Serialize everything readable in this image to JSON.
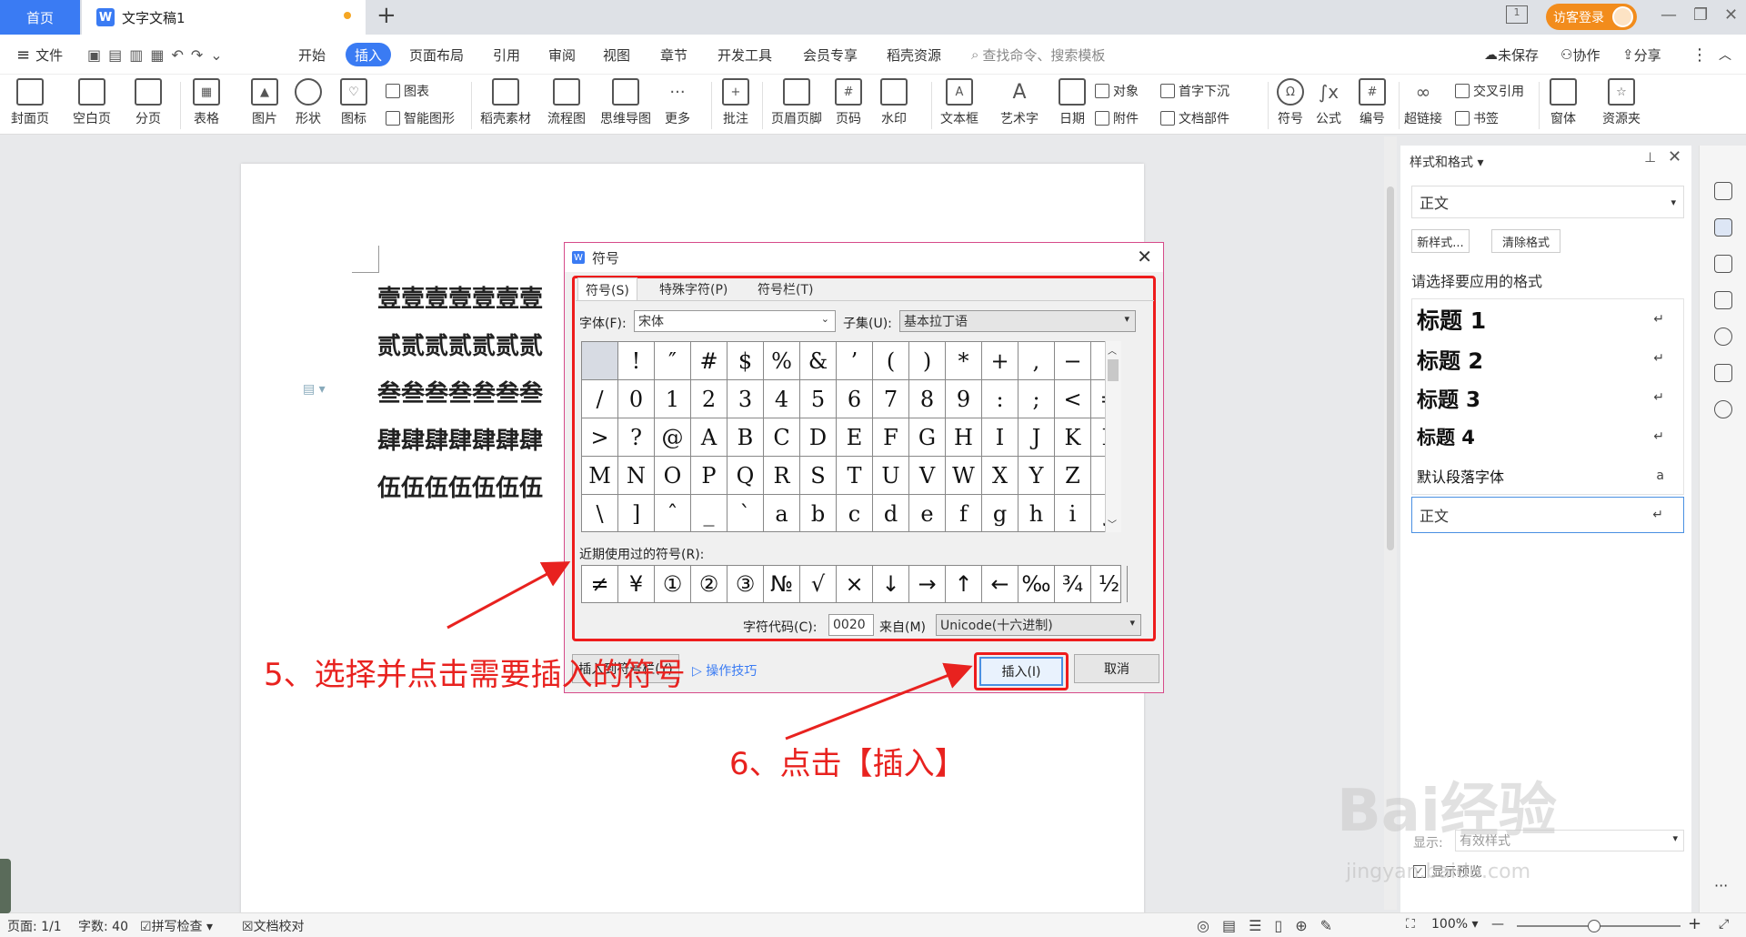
{
  "tabbar": {
    "home": "首页",
    "doc_title": "文字文稿1",
    "new_tab": "+",
    "login": "访客登录"
  },
  "menu": {
    "file": "文件",
    "items": [
      "开始",
      "插入",
      "页面布局",
      "引用",
      "审阅",
      "视图",
      "章节",
      "开发工具",
      "会员专享",
      "稻壳资源"
    ],
    "search": "查找命令、搜索模板",
    "unsaved": "未保存",
    "collab": "协作",
    "share": "分享"
  },
  "ribbon": {
    "cover": "封面页",
    "blank": "空白页",
    "pagebreak": "分页",
    "table": "表格",
    "picture": "图片",
    "shape": "形状",
    "icon": "图标",
    "chart": "图表",
    "smartart": "智能图形",
    "docer": "稻壳素材",
    "flow": "流程图",
    "mind": "思维导图",
    "more": "更多",
    "comment": "批注",
    "header": "页眉页脚",
    "pagenum": "页码",
    "watermark": "水印",
    "textbox": "文本框",
    "wordart": "艺术字",
    "date": "日期",
    "object": "对象",
    "attach": "附件",
    "dropcap": "首字下沉",
    "docpart": "文档部件",
    "symbol": "符号",
    "formula": "公式",
    "numbering": "编号",
    "crossref": "交叉引用",
    "bookmark": "书签",
    "hyperlink": "超链接",
    "window": "窗体",
    "resources": "资源夹"
  },
  "doc": {
    "lines": [
      "壹壹壹壹壹壹壹",
      "贰贰贰贰贰贰贰",
      "叁叁叁叁叁叁叁",
      "肆肆肆肆肆肆肆",
      "伍伍伍伍伍伍伍"
    ]
  },
  "dialog": {
    "title": "符号",
    "tabs": [
      "符号(S)",
      "特殊字符(P)",
      "符号栏(T)"
    ],
    "font_label": "字体(F):",
    "font_value": "宋体",
    "subset_label": "子集(U):",
    "subset_value": "基本拉丁语",
    "symbols": [
      " ",
      "!",
      "″",
      "#",
      "$",
      "%",
      "&",
      "’",
      "(",
      ")",
      "*",
      "+",
      ",",
      "−",
      ".",
      "/",
      "0",
      "1",
      "2",
      "3",
      "4",
      "5",
      "6",
      "7",
      "8",
      "9",
      ":",
      ";",
      "<",
      "=",
      ">",
      "?",
      "@",
      "A",
      "B",
      "C",
      "D",
      "E",
      "F",
      "G",
      "H",
      "I",
      "J",
      "K",
      "L",
      "M",
      "N",
      "O",
      "P",
      "Q",
      "R",
      "S",
      "T",
      "U",
      "V",
      "W",
      "X",
      "Y",
      "Z",
      "[",
      "\\",
      "]",
      "ˆ",
      "_",
      "ˋ",
      "a",
      "b",
      "c",
      "d",
      "e",
      "f",
      "g",
      "h",
      "i",
      "j"
    ],
    "recent_label": "近期使用过的符号(R):",
    "recent": [
      "≠",
      "¥",
      "①",
      "②",
      "③",
      "№",
      "√",
      "×",
      "↓",
      "→",
      "↑",
      "←",
      "‰",
      "¾",
      "½"
    ],
    "code_label": "字符代码(C):",
    "code_value": "0020",
    "from_label": "来自(M)",
    "from_value": "Unicode(十六进制)",
    "insert_to_bar": "插入到符号栏(Y)",
    "tips": "操作技巧",
    "insert": "插入(I)",
    "cancel": "取消"
  },
  "panel": {
    "title": "样式和格式",
    "current": "正文",
    "new_style": "新样式...",
    "clear_format": "清除格式",
    "prompt": "请选择要应用的格式",
    "styles": [
      "标题 1",
      "标题 2",
      "标题 3",
      "标题 4"
    ],
    "default_font": "默认段落字体",
    "default_font_mark": "a",
    "body": "正文",
    "show_label": "显示:",
    "show_value": "有效样式",
    "preview": "显示预览"
  },
  "status": {
    "page": "页面: 1/1",
    "words": "字数: 40",
    "spell": "拼写检查",
    "proof": "文档校对",
    "zoom": "100%"
  },
  "annotations": {
    "step5": "5、选择并点击需要插入的符号",
    "step6": "6、点击【插入】"
  },
  "watermark": {
    "brand": "Bai经验",
    "url": "jingyan.baidu.com"
  },
  "colors": {
    "accent": "#3a7bf3",
    "annotation": "#e8221f",
    "login": "#f28c1c"
  }
}
